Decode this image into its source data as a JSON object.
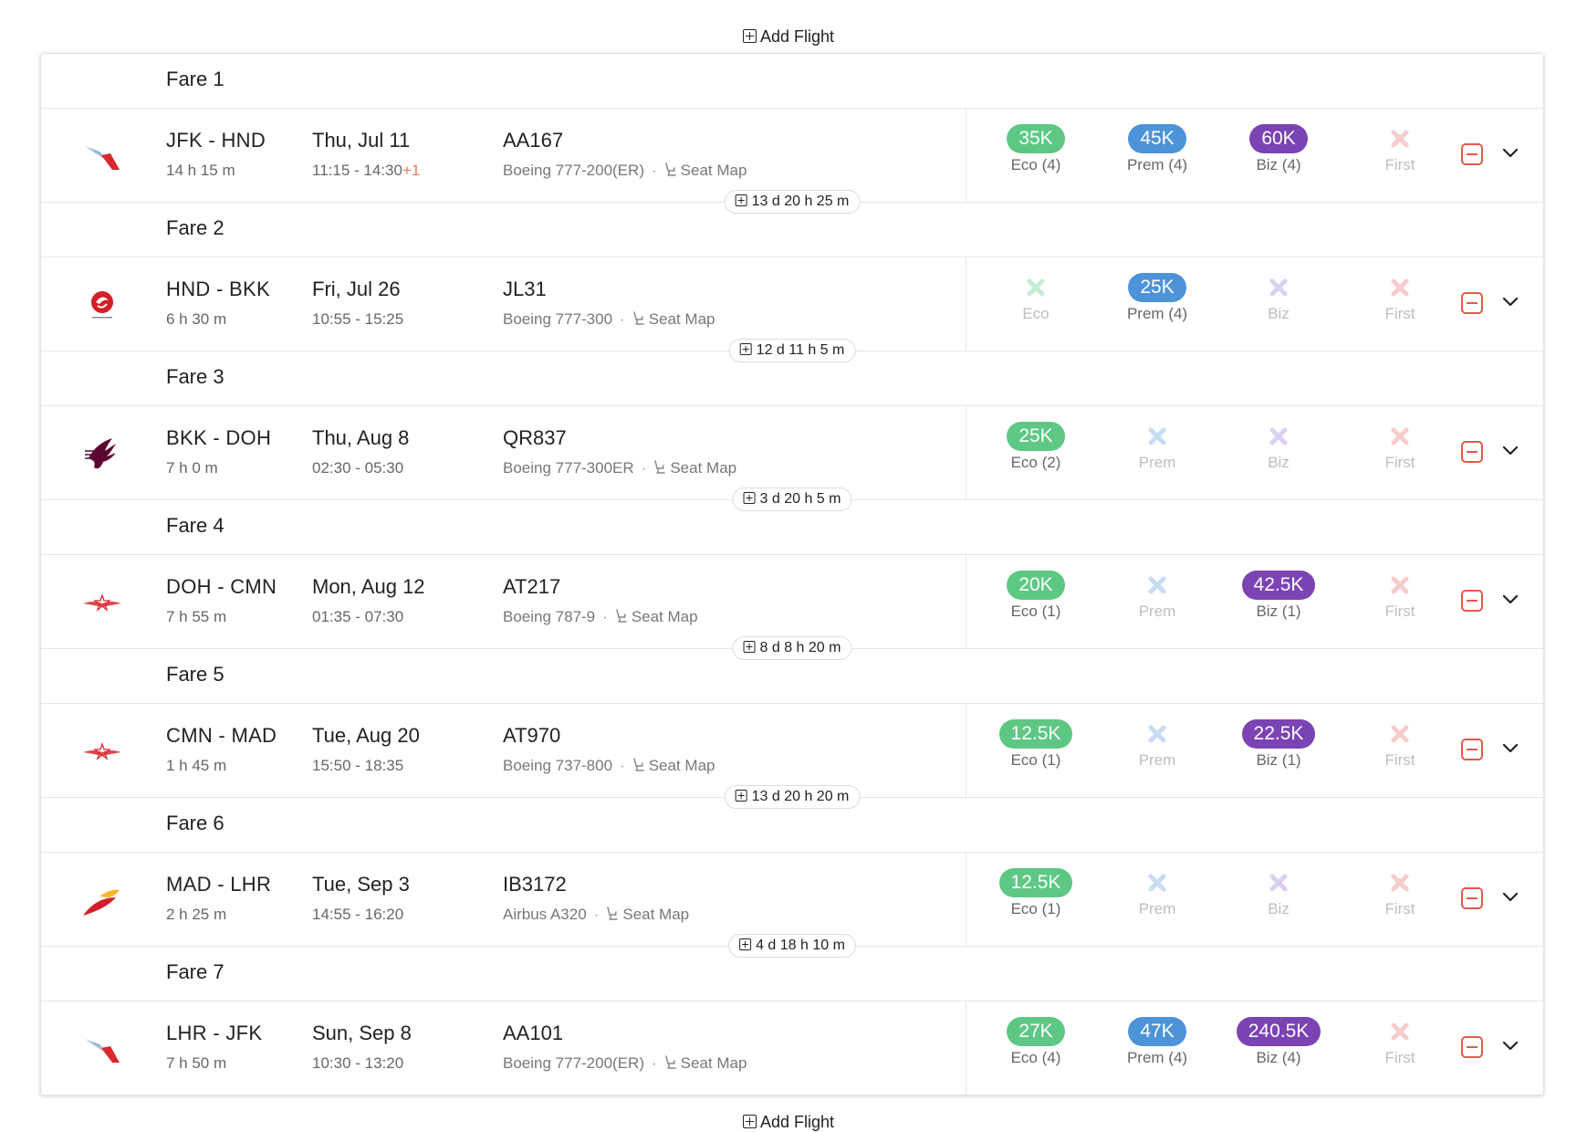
{
  "add_flight_label": "Add Flight",
  "colors": {
    "eco": "#5ec784",
    "prem": "#4c93d8",
    "biz": "#7b43b3",
    "remove": "#e05a4a"
  },
  "fares": [
    {
      "label": "Fare 1",
      "airline_logo": "american-airlines-logo",
      "route": "JFK - HND",
      "duration": "14 h 15 m",
      "date": "Thu, Jul 11",
      "times": "11:15 - 14:30",
      "plus_day": "+1",
      "flight_number": "AA167",
      "aircraft": "Boeing 777-200(ER)",
      "seat_map_label": "Seat Map",
      "cabins": [
        {
          "label": "Eco (4)",
          "price": "35K",
          "available": true
        },
        {
          "label": "Prem (4)",
          "price": "45K",
          "available": true
        },
        {
          "label": "Biz (4)",
          "price": "60K",
          "available": true
        },
        {
          "label": "First",
          "price": "",
          "available": false
        }
      ],
      "gap": "13 d 20 h 25 m"
    },
    {
      "label": "Fare 2",
      "airline_logo": "japan-airlines-logo",
      "route": "HND - BKK",
      "duration": "6 h 30 m",
      "date": "Fri, Jul 26",
      "times": "10:55 - 15:25",
      "plus_day": "",
      "flight_number": "JL31",
      "aircraft": "Boeing 777-300",
      "seat_map_label": "Seat Map",
      "cabins": [
        {
          "label": "Eco",
          "price": "",
          "available": false
        },
        {
          "label": "Prem (4)",
          "price": "25K",
          "available": true
        },
        {
          "label": "Biz",
          "price": "",
          "available": false
        },
        {
          "label": "First",
          "price": "",
          "available": false
        }
      ],
      "gap": "12 d 11 h 5 m"
    },
    {
      "label": "Fare 3",
      "airline_logo": "qatar-airways-logo",
      "route": "BKK - DOH",
      "duration": "7 h 0 m",
      "date": "Thu, Aug 8",
      "times": "02:30 - 05:30",
      "plus_day": "",
      "flight_number": "QR837",
      "aircraft": "Boeing 777-300ER",
      "seat_map_label": "Seat Map",
      "cabins": [
        {
          "label": "Eco (2)",
          "price": "25K",
          "available": true
        },
        {
          "label": "Prem",
          "price": "",
          "available": false
        },
        {
          "label": "Biz",
          "price": "",
          "available": false
        },
        {
          "label": "First",
          "price": "",
          "available": false
        }
      ],
      "gap": "3 d 20 h 5 m"
    },
    {
      "label": "Fare 4",
      "airline_logo": "royal-air-maroc-logo",
      "route": "DOH - CMN",
      "duration": "7 h 55 m",
      "date": "Mon, Aug 12",
      "times": "01:35 - 07:30",
      "plus_day": "",
      "flight_number": "AT217",
      "aircraft": "Boeing 787-9",
      "seat_map_label": "Seat Map",
      "cabins": [
        {
          "label": "Eco (1)",
          "price": "20K",
          "available": true
        },
        {
          "label": "Prem",
          "price": "",
          "available": false
        },
        {
          "label": "Biz (1)",
          "price": "42.5K",
          "available": true
        },
        {
          "label": "First",
          "price": "",
          "available": false
        }
      ],
      "gap": "8 d 8 h 20 m"
    },
    {
      "label": "Fare 5",
      "airline_logo": "royal-air-maroc-logo",
      "route": "CMN - MAD",
      "duration": "1 h 45 m",
      "date": "Tue, Aug 20",
      "times": "15:50 - 18:35",
      "plus_day": "",
      "flight_number": "AT970",
      "aircraft": "Boeing 737-800",
      "seat_map_label": "Seat Map",
      "cabins": [
        {
          "label": "Eco (1)",
          "price": "12.5K",
          "available": true
        },
        {
          "label": "Prem",
          "price": "",
          "available": false
        },
        {
          "label": "Biz (1)",
          "price": "22.5K",
          "available": true
        },
        {
          "label": "First",
          "price": "",
          "available": false
        }
      ],
      "gap": "13 d 20 h 20 m"
    },
    {
      "label": "Fare 6",
      "airline_logo": "iberia-logo",
      "route": "MAD - LHR",
      "duration": "2 h 25 m",
      "date": "Tue, Sep 3",
      "times": "14:55 - 16:20",
      "plus_day": "",
      "flight_number": "IB3172",
      "aircraft": "Airbus A320",
      "seat_map_label": "Seat Map",
      "cabins": [
        {
          "label": "Eco (1)",
          "price": "12.5K",
          "available": true
        },
        {
          "label": "Prem",
          "price": "",
          "available": false
        },
        {
          "label": "Biz",
          "price": "",
          "available": false
        },
        {
          "label": "First",
          "price": "",
          "available": false
        }
      ],
      "gap": "4 d 18 h 10 m"
    },
    {
      "label": "Fare 7",
      "airline_logo": "american-airlines-logo",
      "route": "LHR - JFK",
      "duration": "7 h 50 m",
      "date": "Sun, Sep 8",
      "times": "10:30 - 13:20",
      "plus_day": "",
      "flight_number": "AA101",
      "aircraft": "Boeing 777-200(ER)",
      "seat_map_label": "Seat Map",
      "cabins": [
        {
          "label": "Eco (4)",
          "price": "27K",
          "available": true
        },
        {
          "label": "Prem (4)",
          "price": "47K",
          "available": true
        },
        {
          "label": "Biz (4)",
          "price": "240.5K",
          "available": true
        },
        {
          "label": "First",
          "price": "",
          "available": false
        }
      ],
      "gap": ""
    }
  ]
}
